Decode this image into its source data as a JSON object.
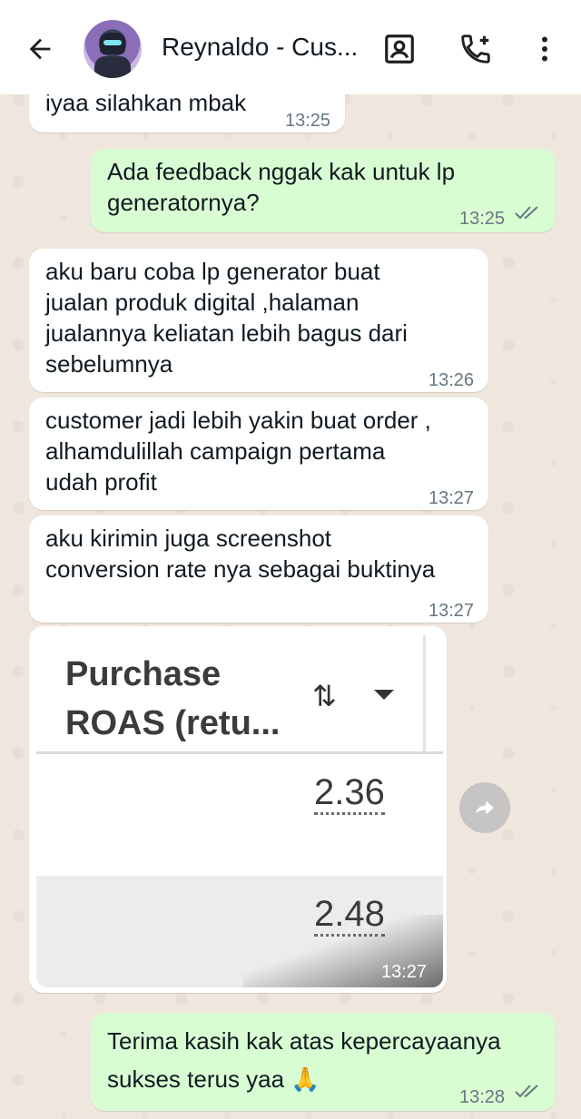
{
  "header": {
    "back_icon": "arrow-left-icon",
    "contact_name": "Reynaldo - Cus...",
    "icons": [
      "contact-card-icon",
      "add-call-icon",
      "more-vert-icon"
    ]
  },
  "messages": [
    {
      "direction": "in",
      "text": "iyaa silahkan mbak",
      "time": "13:25"
    },
    {
      "direction": "out",
      "text": "Ada feedback nggak kak untuk lp\ngeneratornya?",
      "time": "13:25",
      "status": "read"
    },
    {
      "direction": "in",
      "text": "aku baru coba lp generator buat\njualan produk digital ,halaman\njualannya keliatan lebih bagus dari\nsebelumnya",
      "time": "13:26"
    },
    {
      "direction": "in",
      "text": "customer jadi lebih yakin buat order ,\nalhamdulillah campaign pertama\nudah profit",
      "time": "13:27"
    },
    {
      "direction": "in",
      "text": "aku kirimin juga screenshot\nconversion rate nya sebagai buktinya",
      "time": "13:27"
    },
    {
      "direction": "in",
      "type": "image",
      "time": "13:27",
      "image": {
        "column_header": "Purchase\nROAS (retu...",
        "sort_glyph": "⇅",
        "rows": [
          "2.36",
          "2.48"
        ]
      }
    },
    {
      "direction": "out",
      "text": "Terima kasih kak atas kepercayaanya\nsukses terus yaa 🙏",
      "time": "13:28",
      "status": "read"
    }
  ],
  "colors": {
    "incoming_bubble": "#ffffff",
    "outgoing_bubble": "#d9fdd3",
    "wallpaper": "#efe7dd",
    "read_ticks": "#667781"
  }
}
